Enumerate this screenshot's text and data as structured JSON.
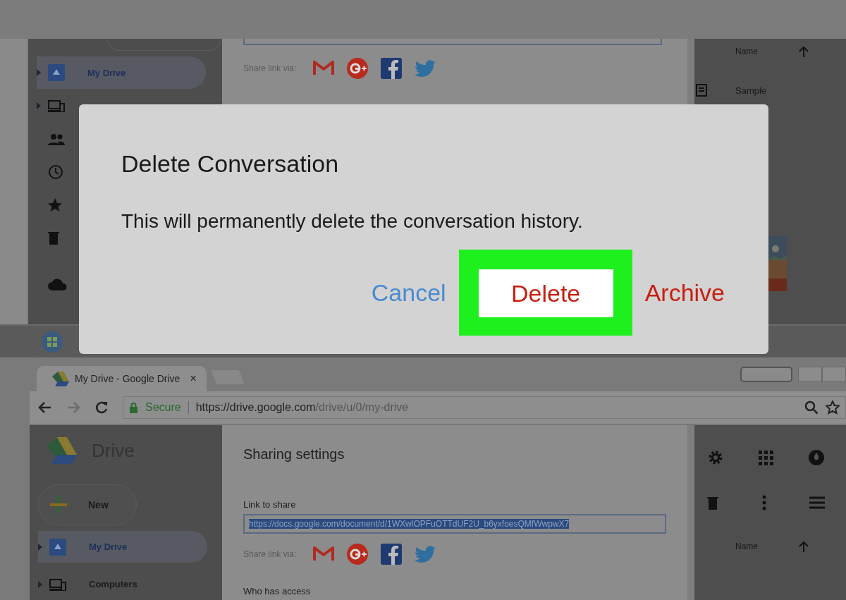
{
  "upper_screen": {
    "sidebar": {
      "items": [
        {
          "label": "My Drive",
          "selected": true
        }
      ]
    },
    "share": {
      "label": "Share link via:"
    },
    "file_list": {
      "column": "Name",
      "rows": [
        "Sample"
      ]
    }
  },
  "lower_window": {
    "tab": {
      "title": "My Drive - Google Drive",
      "close": "×"
    },
    "address_bar": {
      "security": "Secure",
      "url_host": "https://drive.google.com",
      "url_path": "/drive/u/0/my-drive"
    },
    "app_name": "Drive",
    "new_button": "New",
    "sidebar": {
      "items": [
        {
          "label": "My Drive",
          "selected": true
        },
        {
          "label": "Computers",
          "selected": false
        }
      ]
    },
    "sharing": {
      "title": "Sharing settings",
      "link_label": "Link to share",
      "link": "https://docs.google.com/document/d/1WXwlOPFuOTTdUF2U_b6yxfoesQMfWwpwX7",
      "share_label": "Share link via:",
      "access_label": "Who has access"
    },
    "file_list": {
      "column": "Name"
    }
  },
  "dialog": {
    "title": "Delete Conversation",
    "message": "This will permanently delete the conversation history.",
    "buttons": [
      {
        "label": "Cancel",
        "kind": "neutral",
        "highlighted": false
      },
      {
        "label": "Delete",
        "kind": "destructive",
        "highlighted": true
      },
      {
        "label": "Archive",
        "kind": "destructive",
        "highlighted": false
      }
    ]
  }
}
